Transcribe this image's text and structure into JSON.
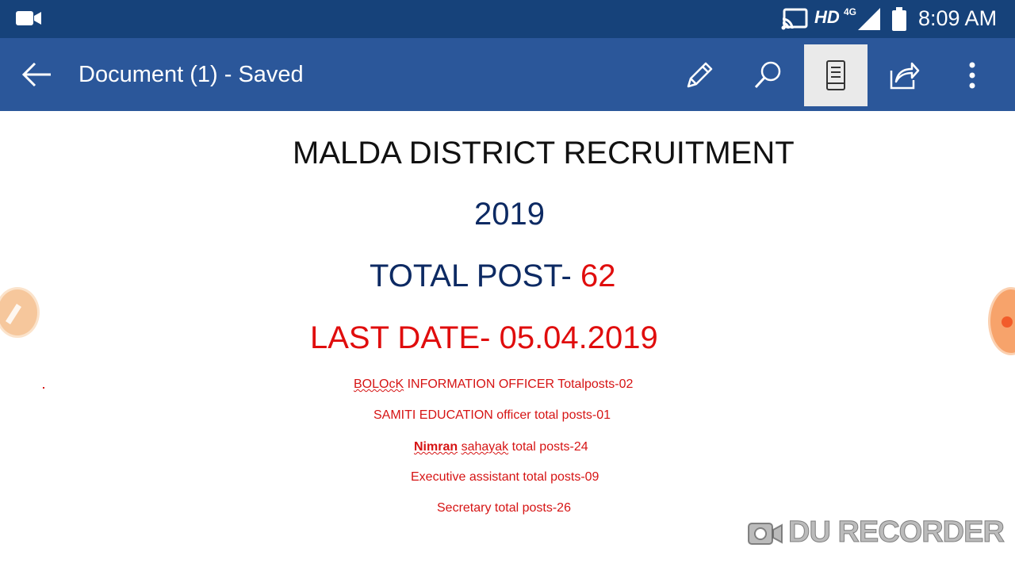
{
  "status_bar": {
    "hd": "HD",
    "network": "4G",
    "time": "8:09 AM",
    "icons": [
      "video-camera-icon",
      "cast-icon",
      "signal-icon",
      "battery-icon"
    ]
  },
  "app_bar": {
    "title": "Document (1) - Saved",
    "color": "#2b579a",
    "icons": [
      "back-arrow-icon",
      "pencil-icon",
      "search-icon",
      "mobile-view-icon",
      "share-icon",
      "more-vert-icon"
    ]
  },
  "document": {
    "heading": "MALDA DISTRICT RECRUITMENT",
    "year": "2019",
    "total_post_label": "TOTAL POST- ",
    "total_post_value": "62",
    "last_date": "LAST DATE- 05.04.2019",
    "posts": [
      {
        "name": "BOLOcK",
        "rest": " INFORMATION OFFICER  Totalposts-02"
      },
      {
        "text": "SAMITI EDUCATION officer total posts-01"
      },
      {
        "name": "Nimran",
        "mid": " ",
        "name2": "sahayak",
        "rest": " total posts-24"
      },
      {
        "text": "Executive assistant total posts-09"
      },
      {
        "text": "Secretary total posts-26"
      }
    ],
    "colors": {
      "red": "#e00d0d",
      "navy": "#0d2a63"
    }
  },
  "overlay": {
    "watermark": "DU RECORDER"
  }
}
